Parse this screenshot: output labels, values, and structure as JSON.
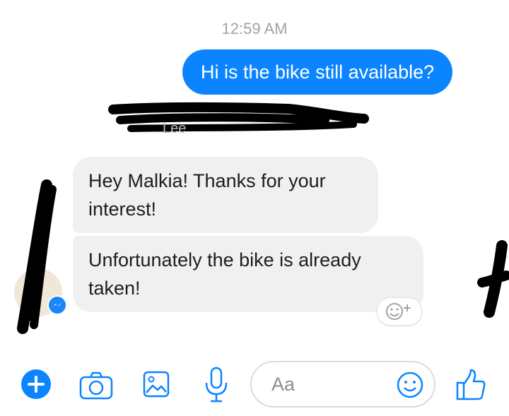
{
  "conversation": {
    "timestamp": "12:59 AM",
    "outgoing": [
      {
        "text": "Hi is the bike still available?"
      }
    ],
    "incoming": [
      {
        "text": "Hey Malkia! Thanks for your interest!"
      },
      {
        "text": "Unfortunately the bike is already taken!"
      }
    ]
  },
  "composer": {
    "placeholder": "Aa"
  },
  "icons": {
    "add": "plus-icon",
    "camera": "camera-icon",
    "gallery": "image-icon",
    "voice": "microphone-icon",
    "emoji": "emoji-icon",
    "like": "thumbs-up-icon",
    "reaction": "add-reaction-icon",
    "badge": "messenger-icon"
  },
  "colors": {
    "accent": "#0b84ff",
    "outgoing_bubble": "#0b84ff",
    "incoming_bubble": "#f1f0f0",
    "timestamp": "#9ea3aa",
    "redaction": "#000000"
  }
}
